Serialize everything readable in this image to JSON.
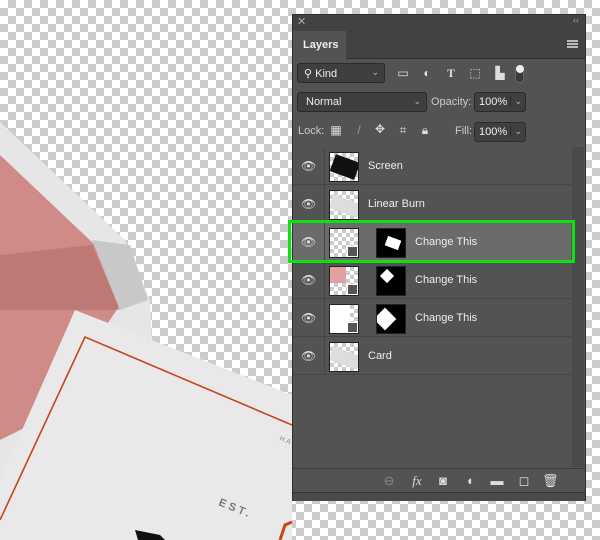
{
  "canvas": {
    "card_text_est": "EST.",
    "card_text_partial": "HA",
    "colors": {
      "pink": "#d08a88",
      "card_border": "#c8451b"
    }
  },
  "panel": {
    "close_icon": "close-icon",
    "collapse_icon": "double-chevron-icon",
    "tab": "Layers",
    "filter": {
      "kind": "Kind",
      "icons": [
        "image-filter-icon",
        "adjustment-filter-icon",
        "type-filter-icon",
        "shape-filter-icon",
        "smart-object-filter-icon"
      ]
    },
    "blend_mode": "Normal",
    "opacity_label": "Opacity:",
    "opacity": "100%",
    "lock_label": "Lock:",
    "fill_label": "Fill:",
    "fill": "100%",
    "layers": [
      {
        "name": "Screen",
        "mask": false,
        "smart": false,
        "visible": true
      },
      {
        "name": "Linear Burn",
        "mask": false,
        "smart": false,
        "visible": true
      },
      {
        "name": "Change This",
        "mask": true,
        "smart": true,
        "visible": true,
        "selected": true
      },
      {
        "name": "Change This",
        "mask": true,
        "smart": true,
        "visible": true
      },
      {
        "name": "Change This",
        "mask": true,
        "smart": true,
        "visible": true
      },
      {
        "name": "Card",
        "mask": false,
        "smart": false,
        "visible": true
      }
    ],
    "footer_icons": [
      "link-icon",
      "fx-icon",
      "mask-icon",
      "adjustment-icon",
      "folder-icon",
      "new-layer-icon",
      "trash-icon"
    ],
    "highlight_color": "#10e010"
  }
}
